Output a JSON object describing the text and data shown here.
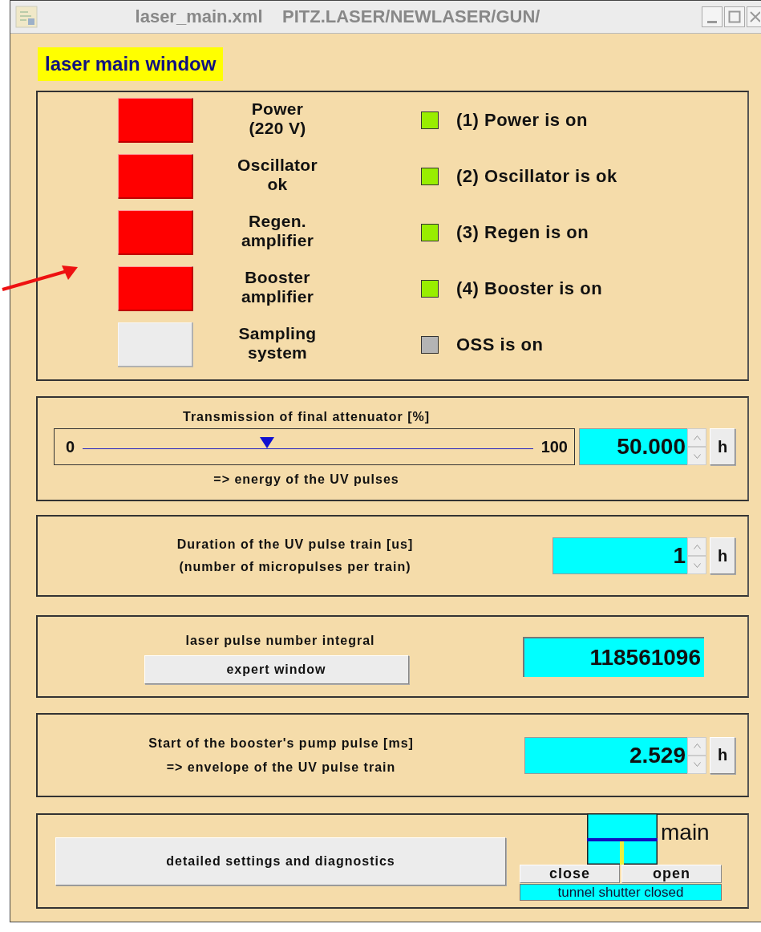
{
  "window": {
    "title": "laser_main.xml    PITZ.LASER/NEWLASER/GUN/"
  },
  "header": "laser main window",
  "subsystems": [
    {
      "button": {
        "label": "Power\n(220 V)",
        "color": "#ff0000"
      },
      "lamp": {
        "label": "(1) Power is on",
        "color": "#99ee00"
      }
    },
    {
      "button": {
        "label": "Oscillator\nok",
        "color": "#ff0000"
      },
      "lamp": {
        "label": "(2) Oscillator is ok",
        "color": "#99ee00"
      }
    },
    {
      "button": {
        "label": "Regen.\namplifier",
        "color": "#ff0000"
      },
      "lamp": {
        "label": "(3) Regen is on",
        "color": "#99ee00"
      }
    },
    {
      "button": {
        "label": "Booster\namplifier",
        "color": "#ff0000"
      },
      "lamp": {
        "label": "(4) Booster is on",
        "color": "#99ee00"
      }
    },
    {
      "button": {
        "label": "Sampling\nsystem",
        "color": "#ececec"
      },
      "lamp": {
        "label": "OSS is on",
        "color": "#b4b4b4"
      }
    }
  ],
  "attenuator": {
    "title": "Transmission of final attenuator [%]",
    "min": "0",
    "max": "100",
    "level": 0.41,
    "value": "50.000",
    "history_button": "h",
    "subtitle": "=> energy of the UV pulses"
  },
  "duration": {
    "label": "Duration of the UV pulse train [us]\n(number of micropulses per train)",
    "value": "1",
    "history_button": "h"
  },
  "pulse_integral": {
    "label": "laser pulse number integral",
    "button": "expert window",
    "value": "118561096"
  },
  "booster_pump": {
    "label": "Start of the booster's pump pulse [ms]\n=> envelope of the UV pulse train",
    "value": "2.529",
    "history_button": "h"
  },
  "footer": {
    "button": "detailed settings and diagnostics",
    "shutter": {
      "label": "main",
      "close_button": "close",
      "open_button": "open",
      "status": "tunnel shutter closed"
    }
  }
}
